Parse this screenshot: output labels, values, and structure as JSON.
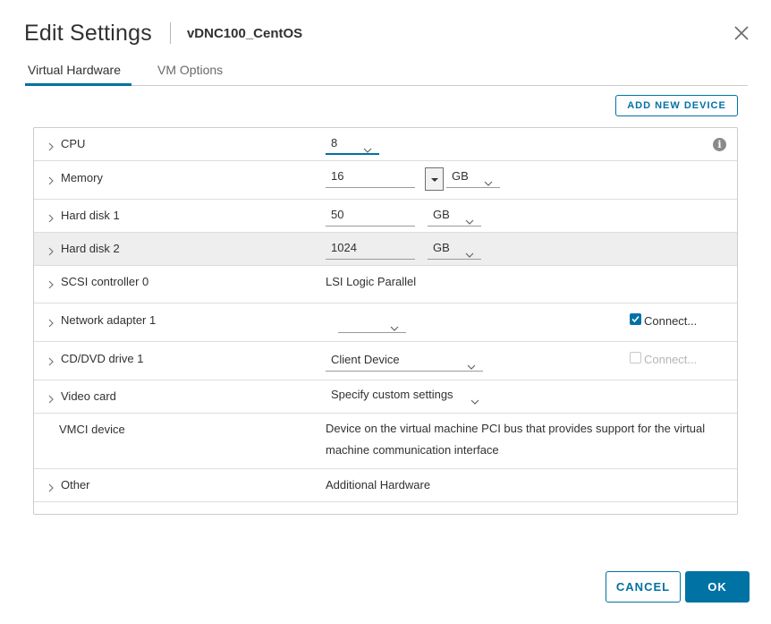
{
  "header": {
    "title": "Edit Settings",
    "vm_name": "vDNC100_CentOS"
  },
  "tabs": [
    {
      "label": "Virtual Hardware",
      "active": true
    },
    {
      "label": "VM Options",
      "active": false
    }
  ],
  "toolbar": {
    "add_new_device_label": "ADD NEW DEVICE"
  },
  "hardware": {
    "cpu": {
      "label": "CPU",
      "value": "8"
    },
    "memory": {
      "label": "Memory",
      "value": "16",
      "unit": "GB"
    },
    "hard_disk_1": {
      "label": "Hard disk 1",
      "value": "50",
      "unit": "GB"
    },
    "hard_disk_2": {
      "label": "Hard disk 2",
      "value": "1024",
      "unit": "GB"
    },
    "scsi": {
      "label": "SCSI controller 0",
      "value": "LSI Logic Parallel"
    },
    "network": {
      "label": "Network adapter 1",
      "value": "",
      "connect_label": "Connect...",
      "connected": true
    },
    "cddvd": {
      "label": "CD/DVD drive 1",
      "value": "Client Device",
      "connect_label": "Connect...",
      "connected": false
    },
    "video": {
      "label": "Video card",
      "value": "Specify custom settings"
    },
    "vmci": {
      "label": "VMCI device",
      "description": "Device on the virtual machine PCI bus that provides support for the virtual machine communication interface"
    },
    "other": {
      "label": "Other",
      "value": "Additional Hardware"
    }
  },
  "footer": {
    "cancel_label": "CANCEL",
    "ok_label": "OK"
  },
  "colors": {
    "accent": "#0072a3",
    "row_highlight": "#eeeeee",
    "border": "#cccccc"
  }
}
